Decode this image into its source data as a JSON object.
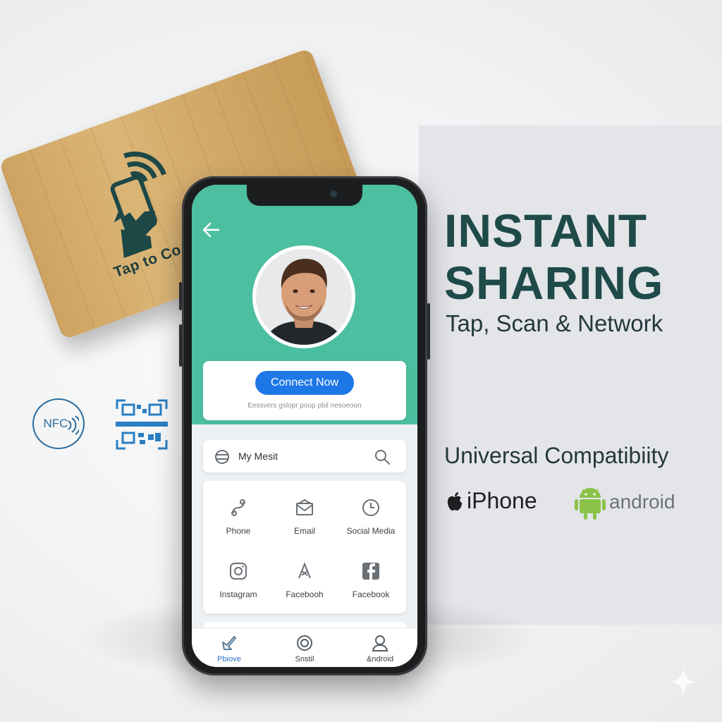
{
  "card": {
    "text": "Tap to Co"
  },
  "badges": {
    "nfc_label": "NFC",
    "nfc_icon": "nfc-icon",
    "qr_icon": "qr-code-icon"
  },
  "phone": {
    "back_icon": "back-arrow-icon",
    "connect": {
      "button_label": "Connect Now",
      "subtext": "Eessvers gslopr poup pbil nesoeoon"
    },
    "search": {
      "text": "My Mesit",
      "icon": "search-icon"
    },
    "contacts": [
      {
        "label": "Phone",
        "icon": "link-icon"
      },
      {
        "label": "Email",
        "icon": "mail-icon"
      },
      {
        "label": "Social Media",
        "icon": "clock-icon"
      },
      {
        "label": "Instagram",
        "icon": "instagram-icon"
      },
      {
        "label": "Facebooh",
        "icon": "share-icon"
      },
      {
        "label": "Facebook",
        "icon": "facebook-icon"
      }
    ],
    "nav": [
      {
        "label": "Pbiove",
        "icon": "pen-icon",
        "active": true
      },
      {
        "label": "Snstil",
        "icon": "circle-icon",
        "active": false
      },
      {
        "label": "&ndroid",
        "icon": "user-icon",
        "active": false
      }
    ]
  },
  "headline": {
    "line1": "INSTANT",
    "line2": "SHARING",
    "sub": "Tap, Scan & Network"
  },
  "compatibility": {
    "title": "Universal Compatibiity",
    "iphone": "iPhone",
    "android": "android"
  },
  "colors": {
    "teal": "#4cbfa0",
    "button_blue": "#1e77e6",
    "headline": "#1f4a4a",
    "android_green": "#8bc34a"
  }
}
